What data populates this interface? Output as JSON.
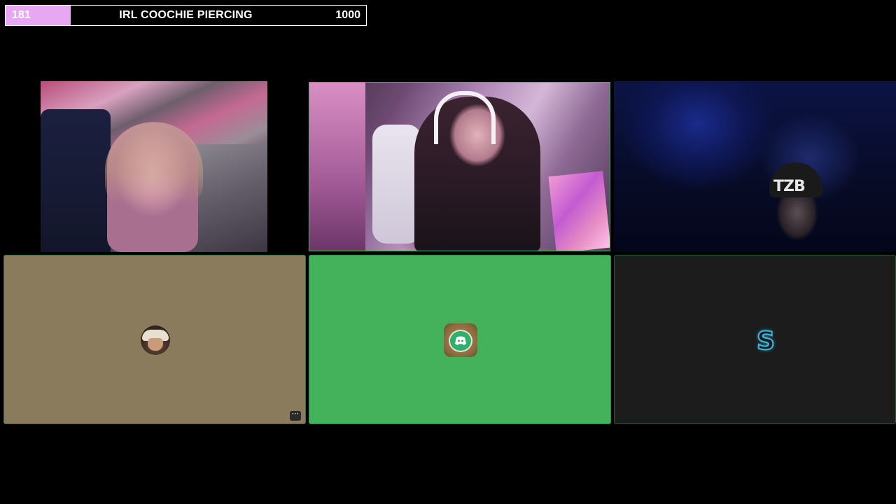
{
  "goal": {
    "current": "181",
    "title": "IRL COOCHIE PIERCING",
    "target": "1000",
    "progress_fraction": 0.181,
    "fill_color": "#e7a7f3"
  },
  "video_tiles": [
    {
      "name": "participant-video-1"
    },
    {
      "name": "participant-video-2",
      "active_speaker": true
    },
    {
      "name": "participant-video-3",
      "beanie_text": "TZB"
    }
  ],
  "avatar_tiles": [
    {
      "name": "participant-avatar-1",
      "background": "#8a7b5c",
      "icon": "cowboy-avatar-icon",
      "more_label": "···"
    },
    {
      "name": "participant-avatar-2",
      "background": "#43b25b",
      "icon": "discord-avatar-icon"
    },
    {
      "name": "participant-avatar-3",
      "background": "#1c1c1c",
      "icon": "s-letter-avatar-icon",
      "letter": "S"
    }
  ],
  "colors": {
    "active_border": "#41b35c",
    "discord_green": "#43b25b"
  }
}
